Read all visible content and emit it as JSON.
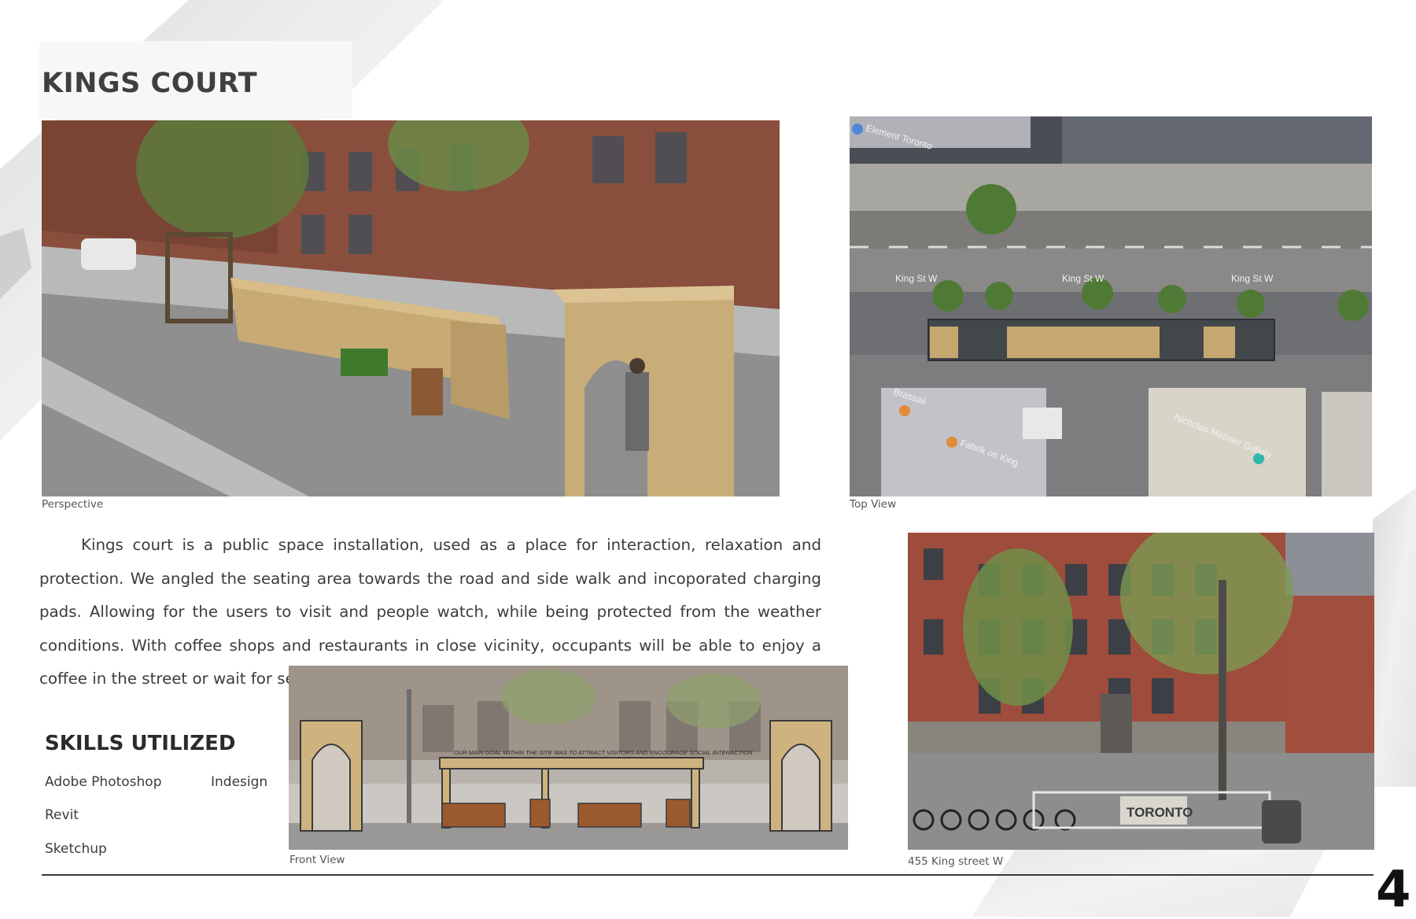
{
  "page": {
    "title": "KINGS COURT",
    "page_number": "4"
  },
  "figures": {
    "perspective": {
      "caption": "Perspective"
    },
    "top_view": {
      "caption": "Top View",
      "labels": [
        "Element Toronto",
        "King St W",
        "King St W",
        "King St W",
        "Brassaii",
        "Fabrik on King",
        "Nicholas Metivier Gallery"
      ]
    },
    "front_view": {
      "caption": "Front View",
      "banner": "OUR MAIN GOAL WITHIN THE SITE WAS TO ATTRACT VISITORS AND ENCOURAGE SOCIAL INTERACTION"
    },
    "street": {
      "caption": "455 King street W",
      "sign": "TORONTO"
    }
  },
  "description": "Kings court is a public space installation, used as a place for interaction, relaxation and protection. We angled the seating area towards the road and side walk and incoporated charging pads. Allowing for the users to visit and people watch, while being protected from the weather conditions. With coffee shops and restaurants in close vicinity, occupants will be able to enjoy a coffee in the street or wait for seating within the restaurants.",
  "skills": {
    "title": "SKILLS UTILIZED",
    "items": [
      "Adobe Photoshop",
      "Indesign",
      "Revit",
      "Sketchup"
    ]
  }
}
